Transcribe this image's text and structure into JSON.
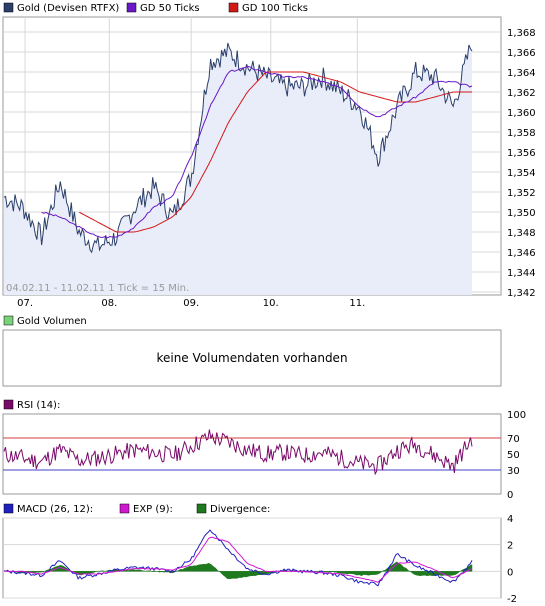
{
  "colors": {
    "price": "#2a3f6a",
    "price_fill": "#e9edf9",
    "gd50": "#6a18c8",
    "gd100": "#d41818",
    "volume_legend": "#7ad27a",
    "rsi": "#7a0a6a",
    "rsi_70": "#d43c3c",
    "rsi_30": "#4040c8",
    "macd": "#2020c0",
    "exp": "#d018d0",
    "divergence": "#1f7a1f"
  },
  "price_panel": {
    "legend": [
      "Gold (Devisen RTFX)",
      "GD 50 Ticks",
      "GD 100 Ticks"
    ],
    "period_note": "04.02.11 - 11.02.11   1 Tick = 15 Min.",
    "y_ticks": [
      "1,368",
      "1,366",
      "1,364",
      "1,362",
      "1,360",
      "1,358",
      "1,356",
      "1,354",
      "1,352",
      "1,350",
      "1,348",
      "1,346",
      "1,344",
      "1,342"
    ],
    "x_ticks": [
      "07.",
      "08.",
      "09.",
      "10.",
      "11."
    ]
  },
  "volume_panel": {
    "legend": "Gold Volumen",
    "message": "keine Volumendaten vorhanden"
  },
  "rsi_panel": {
    "legend": "RSI (14):",
    "y_ticks": [
      "100",
      "70",
      "50",
      "30",
      "0"
    ]
  },
  "macd_panel": {
    "legend": [
      "MACD (26, 12):",
      "EXP (9):",
      "Divergence:"
    ],
    "y_ticks": [
      "4",
      "2",
      "0",
      "-2"
    ]
  },
  "chart_data": [
    {
      "type": "line",
      "title": "Gold (Devisen RTFX)",
      "x_categories": [
        "07.",
        "08.",
        "09.",
        "10.",
        "11."
      ],
      "ylim": [
        1.342,
        1.369
      ],
      "grid": true,
      "legend_position": "top-left",
      "x": [
        0,
        4,
        8,
        12,
        16,
        20,
        24,
        28,
        32,
        36,
        40,
        44,
        48,
        52,
        56,
        60,
        64,
        68,
        72,
        76,
        80,
        84,
        88,
        92,
        96,
        100
      ],
      "series": [
        {
          "name": "Gold (Devisen RTFX)",
          "values": [
            1.3515,
            1.3505,
            1.3475,
            1.353,
            1.348,
            1.3465,
            1.3475,
            1.3505,
            1.3525,
            1.3495,
            1.3535,
            1.365,
            1.366,
            1.3645,
            1.3635,
            1.3625,
            1.3625,
            1.3635,
            1.362,
            1.3605,
            1.3555,
            1.3605,
            1.364,
            1.3635,
            1.3605,
            1.367
          ]
        },
        {
          "name": "GD 50 Ticks",
          "values": [
            null,
            null,
            1.35,
            1.3495,
            1.3485,
            1.3475,
            1.3475,
            1.3485,
            1.3505,
            1.3515,
            1.3555,
            1.3605,
            1.364,
            1.3645,
            1.364,
            1.3635,
            1.3635,
            1.363,
            1.3625,
            1.3605,
            1.3595,
            1.3605,
            1.3615,
            1.363,
            1.363,
            1.3625
          ]
        },
        {
          "name": "GD 100 Ticks",
          "values": [
            null,
            null,
            null,
            null,
            1.35,
            1.349,
            1.348,
            1.348,
            1.3485,
            1.3495,
            1.3515,
            1.355,
            1.359,
            1.362,
            1.364,
            1.364,
            1.364,
            1.3635,
            1.363,
            1.362,
            1.3615,
            1.361,
            1.361,
            1.3615,
            1.362,
            1.362
          ]
        }
      ]
    },
    {
      "type": "line",
      "title": "RSI (14):",
      "ylim": [
        0,
        100
      ],
      "reference_lines": [
        70,
        30
      ],
      "x": [
        0,
        4,
        8,
        12,
        16,
        20,
        24,
        28,
        32,
        36,
        40,
        44,
        48,
        52,
        56,
        60,
        64,
        68,
        72,
        76,
        80,
        84,
        88,
        92,
        96,
        100
      ],
      "series": [
        {
          "name": "RSI (14):",
          "values": [
            50,
            45,
            40,
            55,
            42,
            45,
            50,
            55,
            52,
            48,
            60,
            72,
            65,
            55,
            50,
            52,
            48,
            52,
            45,
            38,
            35,
            55,
            62,
            48,
            35,
            70
          ]
        }
      ]
    },
    {
      "type": "line",
      "title": "MACD (26, 12):",
      "ylim": [
        -2,
        4
      ],
      "x": [
        0,
        4,
        8,
        12,
        16,
        20,
        24,
        28,
        32,
        36,
        40,
        44,
        48,
        52,
        56,
        60,
        64,
        68,
        72,
        76,
        80,
        84,
        88,
        92,
        96,
        100
      ],
      "series": [
        {
          "name": "MACD (26, 12):",
          "values": [
            0.0,
            -0.1,
            -0.3,
            0.8,
            -0.5,
            -0.2,
            0.1,
            0.3,
            0.2,
            0.0,
            0.9,
            3.2,
            1.6,
            0.2,
            -0.2,
            0.1,
            0.0,
            -0.1,
            -0.3,
            -0.8,
            -1.0,
            1.3,
            0.4,
            -0.2,
            -0.8,
            0.7
          ]
        },
        {
          "name": "EXP (9):",
          "values": [
            0.0,
            0.0,
            -0.2,
            0.3,
            -0.2,
            -0.2,
            0.0,
            0.2,
            0.2,
            0.1,
            0.5,
            2.6,
            2.2,
            0.6,
            0.0,
            0.0,
            0.0,
            -0.1,
            -0.2,
            -0.5,
            -0.8,
            0.6,
            0.7,
            0.1,
            -0.5,
            0.2
          ]
        },
        {
          "name": "Divergence:",
          "values": [
            0.0,
            -0.1,
            -0.1,
            0.5,
            -0.3,
            0.0,
            0.1,
            0.1,
            0.0,
            -0.1,
            0.4,
            0.6,
            -0.6,
            -0.4,
            -0.2,
            0.1,
            0.0,
            0.0,
            -0.1,
            -0.3,
            -0.2,
            0.7,
            -0.3,
            -0.3,
            -0.3,
            0.5
          ]
        }
      ]
    }
  ]
}
